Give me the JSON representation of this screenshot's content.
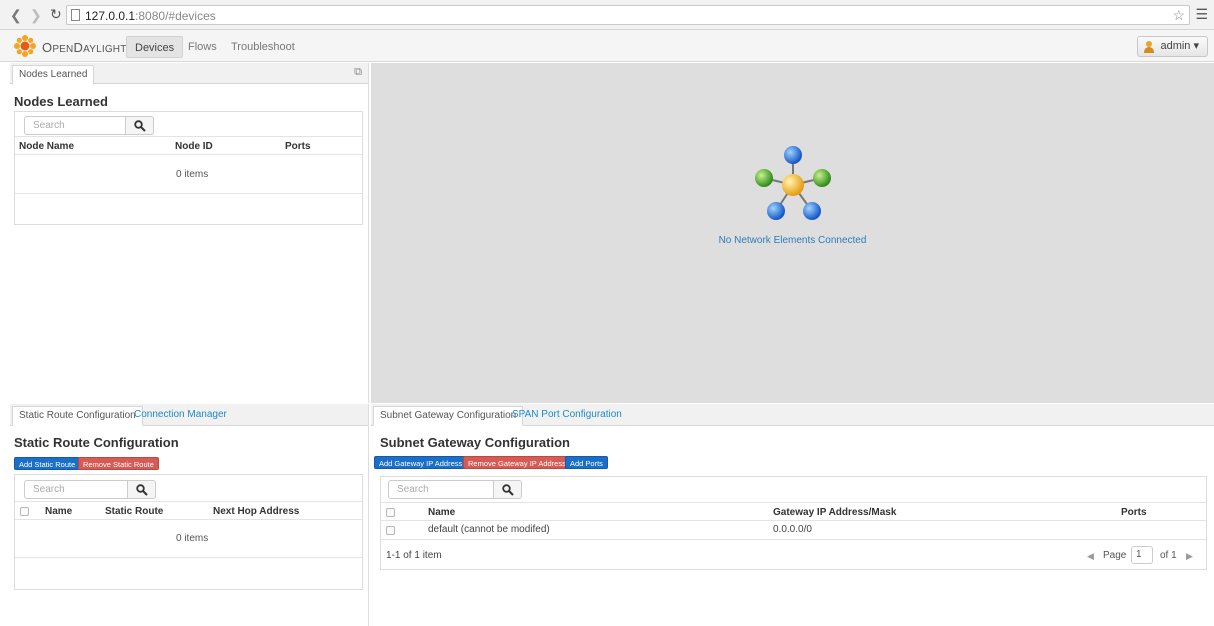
{
  "browser": {
    "url_host": "127.0.0.1",
    "url_rest": ":8080/#devices"
  },
  "app": {
    "brand_first": "O",
    "brand_small": "PEN",
    "brand_second": "D",
    "brand_small2": "AYLIGHT",
    "nav": [
      "Devices",
      "Flows",
      "Troubleshoot"
    ],
    "user": "admin"
  },
  "nodes_panel": {
    "tab": "Nodes Learned",
    "title": "Nodes Learned",
    "search_placeholder": "Search",
    "columns": [
      "Node Name",
      "Node ID",
      "Ports"
    ],
    "empty": "0 items"
  },
  "topology": {
    "message": "No Network Elements Connected"
  },
  "static_panel": {
    "tabs": [
      "Static Route Configuration",
      "Connection Manager"
    ],
    "title": "Static Route Configuration",
    "buttons": {
      "add": "Add Static Route",
      "remove": "Remove Static Route"
    },
    "search_placeholder": "Search",
    "columns": [
      "Name",
      "Static Route",
      "Next Hop Address"
    ],
    "empty": "0 items"
  },
  "subnet_panel": {
    "tabs": [
      "Subnet Gateway Configuration",
      "SPAN Port Configuration"
    ],
    "title": "Subnet Gateway Configuration",
    "buttons": {
      "add": "Add Gateway IP Address",
      "remove": "Remove Gateway IP Address",
      "ports": "Add Ports"
    },
    "search_placeholder": "Search",
    "columns": [
      "Name",
      "Gateway IP Address/Mask",
      "Ports"
    ],
    "rows": [
      {
        "name": "default (cannot be modifed)",
        "gateway": "0.0.0.0/0",
        "ports": ""
      }
    ],
    "count": "1-1 of 1 item",
    "pager": {
      "label": "Page",
      "page": "1",
      "of": "of 1"
    }
  }
}
